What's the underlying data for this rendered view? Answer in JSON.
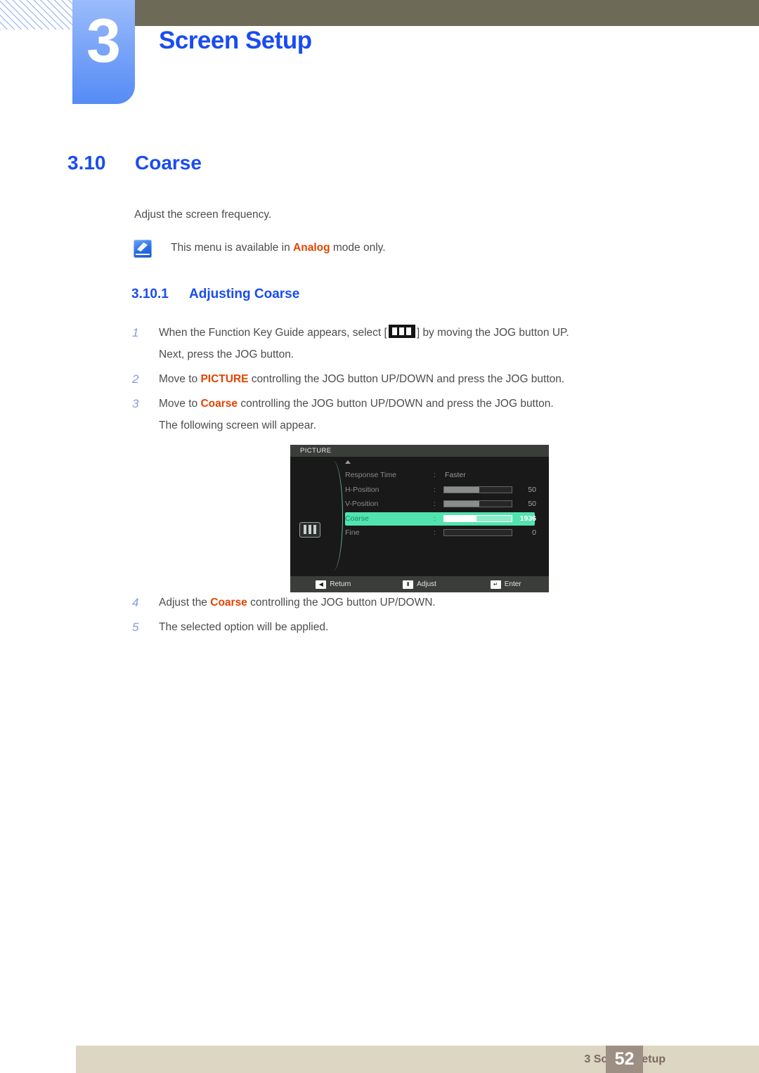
{
  "chapter": {
    "number": "3",
    "title": "Screen Setup"
  },
  "section": {
    "number": "3.10",
    "title": "Coarse"
  },
  "lead_text": "Adjust the screen frequency.",
  "note": {
    "icon": "note-pencil-icon",
    "text_before": "This menu is available in ",
    "highlight": "Analog",
    "text_after": " mode only."
  },
  "subsection": {
    "number": "3.10.1",
    "title": "Adjusting Coarse"
  },
  "steps": [
    {
      "num": "1",
      "line1_a": "When the Function Key Guide appears, select [",
      "icon": "function-key-guide-icon",
      "line1_b": "] by moving the JOG button UP.",
      "line2": "Next, press the JOG button."
    },
    {
      "num": "2",
      "text_before": "Move to ",
      "highlight": "PICTURE",
      "text_after": " controlling the JOG button UP/DOWN and press the JOG button."
    },
    {
      "num": "3",
      "text_before": "Move to ",
      "highlight": "Coarse",
      "text_after": " controlling the JOG button UP/DOWN and press the JOG button.",
      "line2": "The following screen will appear."
    }
  ],
  "steps_late": [
    {
      "num": "4",
      "text_before": "Adjust the ",
      "highlight": "Coarse",
      "text_after": " controlling the JOG button UP/DOWN."
    },
    {
      "num": "5",
      "text_before": "The selected option will be applied.",
      "highlight": "",
      "text_after": ""
    }
  ],
  "osd": {
    "title": "PICTURE",
    "category_icon": "picture-category-icon",
    "scroll_up_icon": "scroll-up-arrow-icon",
    "rows": [
      {
        "label": "Response Time",
        "colon": ":",
        "type": "option",
        "value": "Faster",
        "selected": false
      },
      {
        "label": "H-Position",
        "colon": ":",
        "type": "slider",
        "value": "50",
        "fill_pct": 52,
        "selected": false
      },
      {
        "label": "V-Position",
        "colon": ":",
        "type": "slider",
        "value": "50",
        "fill_pct": 52,
        "selected": false
      },
      {
        "label": "Coarse",
        "colon": ":",
        "type": "slider",
        "value": "1936",
        "fill_pct": 48,
        "selected": true
      },
      {
        "label": "Fine",
        "colon": ":",
        "type": "slider",
        "value": "0",
        "fill_pct": 0,
        "selected": false
      }
    ],
    "footer": [
      {
        "glyph": "◀",
        "label": "Return",
        "icon": "return-left-arrow-icon"
      },
      {
        "glyph": "⬍",
        "label": "Adjust",
        "icon": "adjust-updown-arrow-icon"
      },
      {
        "glyph": "↵",
        "label": "Enter",
        "icon": "enter-key-icon"
      }
    ]
  },
  "footer": {
    "label": "3 Screen Setup",
    "page": "52"
  },
  "colors": {
    "accent_blue": "#1a4cf0",
    "highlight_orange": "#e24500",
    "olive_bar": "#6d6a57",
    "tab_blue": "#7ba5f8",
    "footer_bar": "#dcd6c3",
    "footer_page": "#9e8f85",
    "osd_selected_green": "#52e3b0"
  }
}
